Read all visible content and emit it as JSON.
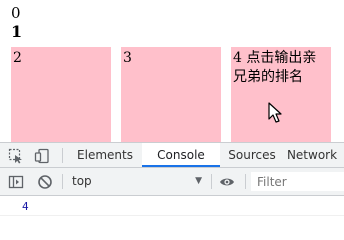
{
  "page": {
    "lines": [
      "0",
      "1"
    ],
    "boxes": [
      {
        "text": "2"
      },
      {
        "text": "3"
      },
      {
        "text": "4 点击输出亲兄弟的排名"
      }
    ],
    "box_color": "#ffc0cb"
  },
  "devtools": {
    "tabs": [
      "Elements",
      "Console",
      "Sources",
      "Network"
    ],
    "active_tab": "Console",
    "context": "top",
    "filter_placeholder": "Filter",
    "output": [
      "4"
    ],
    "accent_color": "#1a73e8"
  }
}
